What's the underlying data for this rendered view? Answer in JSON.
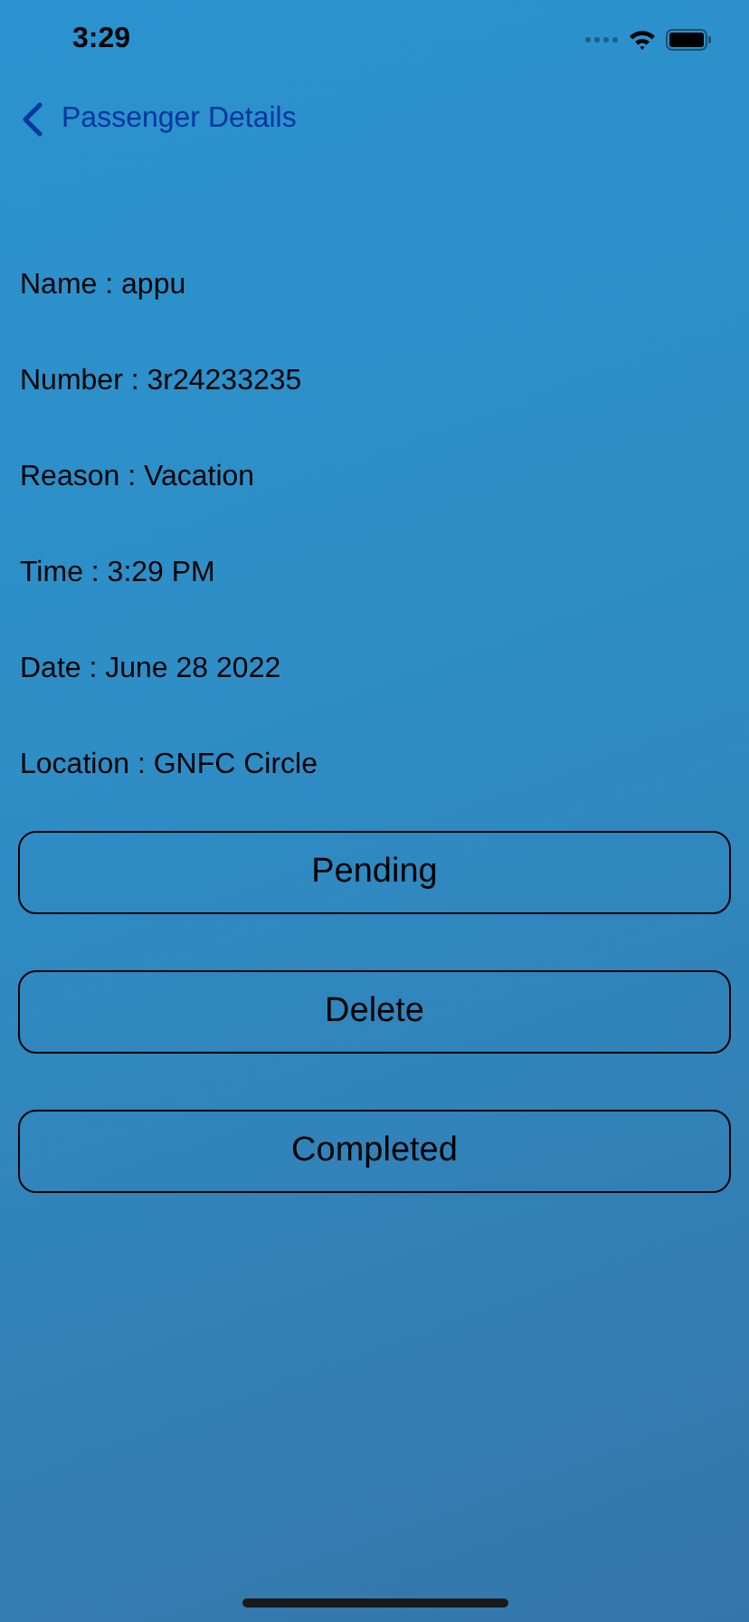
{
  "status_bar": {
    "time": "3:29"
  },
  "nav": {
    "back_label": "Passenger Details"
  },
  "details": [
    "Name : appu",
    "Number : 3r24233235",
    "Reason : Vacation",
    "Time : 3:29 PM",
    "Date : June 28 2022",
    "Location : GNFC Circle"
  ],
  "buttons": [
    "Pending",
    "Delete",
    "Completed"
  ]
}
